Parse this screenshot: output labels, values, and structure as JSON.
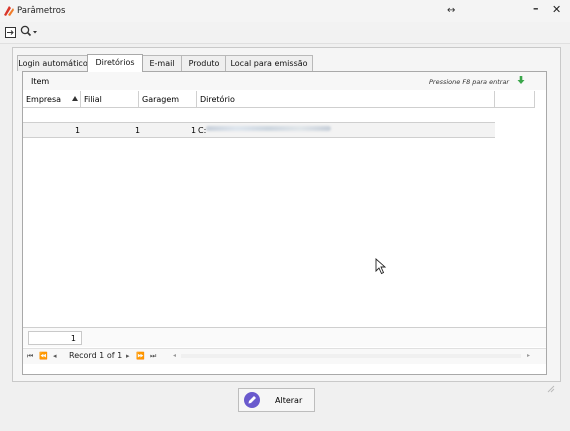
{
  "window": {
    "title": "Parâmetros"
  },
  "tabs": [
    {
      "label": "Login automático",
      "active": false
    },
    {
      "label": "Diretórios",
      "active": true
    },
    {
      "label": "E-mail",
      "active": false
    },
    {
      "label": "Produto",
      "active": false
    },
    {
      "label": "Local para emissão",
      "active": false
    }
  ],
  "grid": {
    "group_title": "Item",
    "hint": "Pressione F8 para entrar",
    "columns": [
      "Empresa",
      "Filial",
      "Garagem",
      "Diretório"
    ],
    "rows": [
      {
        "empresa": "1",
        "filial": "1",
        "garagem": "1",
        "diretorio": "C:"
      }
    ],
    "count": "1",
    "record_label": "Record 1 of 1"
  },
  "actions": {
    "alterar_label": "Alterar"
  },
  "colors": {
    "accent_green": "#3aa64a",
    "button_icon": "#6a5acd",
    "app_icon_red": "#d9362b"
  }
}
